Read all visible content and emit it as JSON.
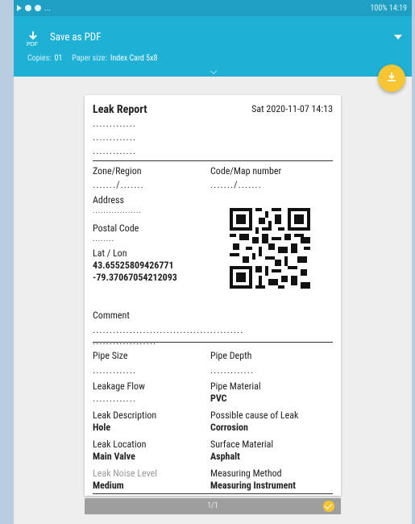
{
  "statusbar": {
    "right": "100% 14:19"
  },
  "printbar": {
    "save_label": "Save as PDF",
    "copies_label": "Copies:",
    "copies_value": "01",
    "paper_label": "Paper size:",
    "paper_value": "Index Card 5x8"
  },
  "report": {
    "title": "Leak Report",
    "date": "Sat 2020-11-07 14:13",
    "header_dots": ".............",
    "zone_label": "Zone/Region",
    "zone_value": "......./.......",
    "code_label": "Code/Map number",
    "code_value": "......./.......",
    "address_label": "Address",
    "address_value": "..................",
    "postal_label": "Postal Code",
    "postal_value": "........",
    "latlon_label": "Lat / Lon",
    "lat_value": "43.65525809426771",
    "lon_value": "-79.37067054212093",
    "comment_label": "Comment",
    "comment_line1": ".............................................",
    "comment_line2": "...................",
    "pipe_size_label": "Pipe Size",
    "pipe_size_value": ".............",
    "pipe_depth_label": "Pipe Depth",
    "pipe_depth_value": ".............",
    "leakage_flow_label": "Leakage Flow",
    "leakage_flow_value": ".............",
    "pipe_material_label": "Pipe Material",
    "pipe_material_value": "PVC",
    "leak_desc_label": "Leak Description",
    "leak_desc_value": "Hole",
    "cause_label": "Possible cause of Leak",
    "cause_value": "Corrosion",
    "leak_location_label": "Leak Location",
    "leak_location_value": "Main Valve",
    "surface_label": "Surface Material",
    "surface_value": "Asphalt",
    "noise_label": "Leak Noise Level",
    "noise_value": "Medium",
    "method_label": "Measuring Method",
    "method_value": "Measuring Instrument"
  },
  "pager": {
    "page": "1/1"
  },
  "colors": {
    "accent": "#1fb0d6",
    "fab": "#f7c531"
  }
}
